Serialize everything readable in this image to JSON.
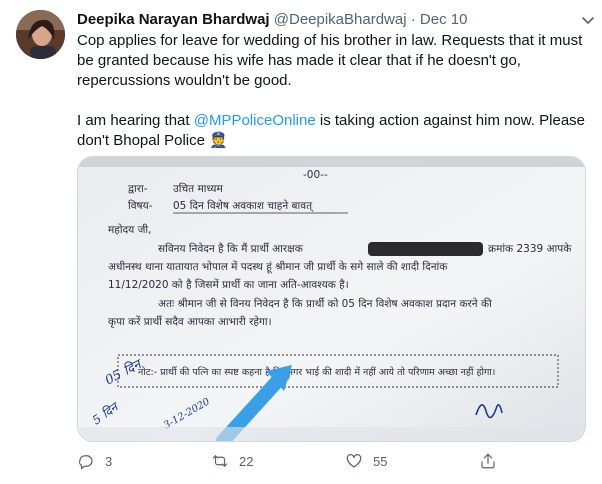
{
  "tweet": {
    "author_name": "Deepika Narayan Bhardwaj",
    "author_handle": "@DeepikaBhardwaj",
    "separator": "·",
    "date": "Dec 10",
    "text_line1": "Cop applies for leave for wedding of his brother in law. Requests that it must",
    "text_line2": "be granted because his wife has made it clear that if he doesn't go,",
    "text_line3": "repercussions wouldn't be good.",
    "text2_before": "I am hearing that ",
    "text2_mention": "@MPPoliceOnline",
    "text2_after_line1": " is taking action against him now. Please",
    "text2_line2": "don't Bhopal Police 👮"
  },
  "document": {
    "header": "-00--",
    "to_label": "द्वारा-",
    "to_value": "उचित माध्यम",
    "subject_label": "विषय-",
    "subject_value": "05 दिन विशेष अवकाश चाहने बावत्",
    "salutation": "महोदय जी,",
    "para1_l1": "सविनय निवेदन है कि मैं प्रार्थी आरक्षक",
    "para1_l1_end": "क्रमांक 2339 आपके",
    "para1_l2": "अधीनस्थ थाना यातायात भोपाल में पदस्थ हूं श्रीमान जी प्रार्थी के सगे साले की शादी दिनांक",
    "para1_l3": "11/12/2020 को है जिसमें प्रार्थी का जाना अति-आवश्यक है।",
    "para2_l1": "अतः श्रीमान जी से विनय निवेदन है कि प्रार्थी को 05 दिन विशेष अवकाश प्रदान करने की",
    "para2_l2": "कृपा करें प्रार्थी सदैव आपका आभारी रहेगा।",
    "note": "नोट:- प्रार्थी की पत्नि का स्पष्ट कहना है कि अगर भाई की शादी में नहीं आये तो परिणाम अच्छा नहीं होगा।",
    "hw_1": "05 दिन",
    "hw_2": "5 दिन",
    "hw_3": "3-12-2020"
  },
  "actions": {
    "reply_count": "3",
    "retweet_count": "22",
    "like_count": "55"
  },
  "colors": {
    "accent": "#1d9bf0",
    "secondary_text": "#536471",
    "primary_text": "#0f1419",
    "arrow_blue": "#3aa0e6"
  },
  "icons": [
    "more-icon",
    "reply-icon",
    "retweet-icon",
    "like-icon",
    "share-icon"
  ]
}
